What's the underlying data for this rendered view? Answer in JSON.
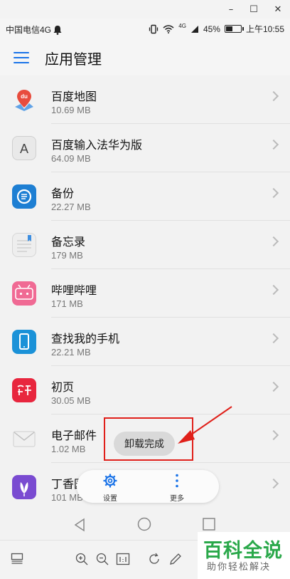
{
  "window": {
    "minimize": "–",
    "maximize": "☐",
    "close": "✕"
  },
  "status_bar": {
    "carrier": "中国电信4G",
    "network_tag": "4G",
    "battery_percent": "45%",
    "battery_level": 0.45,
    "time": "上午10:55"
  },
  "header": {
    "title": "应用管理"
  },
  "apps": [
    {
      "name": "百度地图",
      "size": "10.69 MB",
      "icon": "baidu-map-icon",
      "color": "#ffffff"
    },
    {
      "name": "百度输入法华为版",
      "size": "64.09 MB",
      "icon": "baidu-input-icon",
      "color": "#e9e9e9"
    },
    {
      "name": "备份",
      "size": "22.27 MB",
      "icon": "backup-icon",
      "color": "#1e7fd3"
    },
    {
      "name": "备忘录",
      "size": "179 MB",
      "icon": "memo-icon",
      "color": "#eeeeee"
    },
    {
      "name": "哔哩哔哩",
      "size": "171 MB",
      "icon": "bilibili-icon",
      "color": "#f06a94"
    },
    {
      "name": "查找我的手机",
      "size": "22.21 MB",
      "icon": "find-phone-icon",
      "color": "#1b92d8"
    },
    {
      "name": "初页",
      "size": "30.05 MB",
      "icon": "chuye-icon",
      "color": "#e8263e"
    },
    {
      "name": "电子邮件",
      "size": "1.02 MB",
      "icon": "email-icon",
      "color": "#f0f0f0"
    },
    {
      "name": "丁香园",
      "size": "101 MB",
      "icon": "dingxiangyuan-icon",
      "color": "#7a4bd1"
    }
  ],
  "bottom_bar": {
    "settings_label": "设置",
    "more_label": "更多"
  },
  "toast": {
    "text": "卸载完成"
  },
  "accent_color": "#1a73e8",
  "highlight_color": "#e0201a",
  "watermark": {
    "title": "百科全说",
    "subtitle": "助你轻松解决"
  }
}
